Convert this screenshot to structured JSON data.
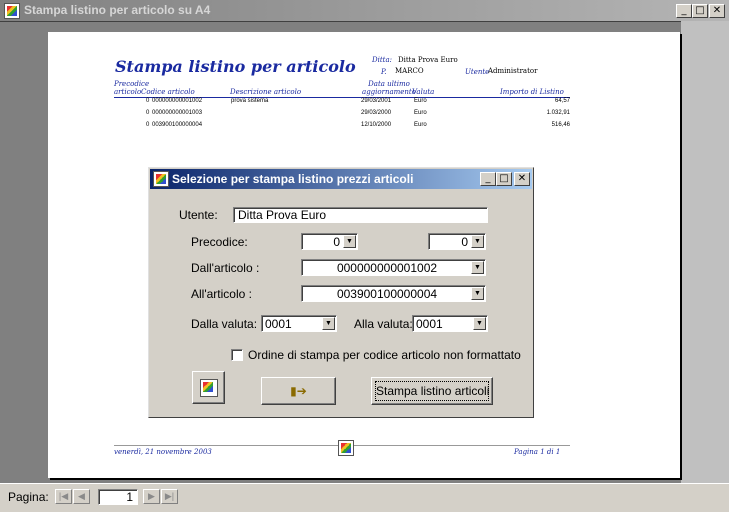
{
  "window": {
    "title": "Stampa listino per articolo su A4"
  },
  "titlebar_buttons": {
    "min": "_",
    "max": "□",
    "close": "✕"
  },
  "report": {
    "title": "Stampa listino per articolo",
    "ditta_label": "Ditta:",
    "ditta_value": "Ditta Prova Euro",
    "p_label": "P.",
    "p_value": "MARCO",
    "utente_label": "Utente",
    "utente_value": "Administrator",
    "columns": {
      "precodice": [
        "Precodice",
        "articolo"
      ],
      "codice": "Codice articolo",
      "descrizione": "Descrizione articolo",
      "data": [
        "Data ultimo",
        "aggiornamento"
      ],
      "valuta": "Valuta",
      "importo": "Importo di Listino"
    },
    "rows": [
      {
        "precodice": "0",
        "codice": "000000000001002",
        "descrizione": "prova sistema",
        "data": "29/03/2001",
        "valuta": "Euro",
        "importo": "64,57"
      },
      {
        "precodice": "0",
        "codice": "000000000001003",
        "descrizione": "",
        "data": "29/03/2000",
        "valuta": "Euro",
        "importo": "1.032,91"
      },
      {
        "precodice": "0",
        "codice": "003900100000004",
        "descrizione": "",
        "data": "12/10/2000",
        "valuta": "Euro",
        "importo": "516,46"
      }
    ],
    "footer_date": "venerdì, 21 novembre 2003",
    "footer_page": "Pagina 1 di 1"
  },
  "dialog": {
    "title": "Selezione per stampa listino prezzi articoli",
    "utente_label": "Utente:",
    "utente_value": "Ditta Prova Euro",
    "precodice_label": "Precodice:",
    "precodice_from": "0",
    "precodice_to": "0",
    "dall_articolo_label": "Dall'articolo :",
    "dall_articolo_value": "000000000001002",
    "all_articolo_label": "All'articolo :",
    "all_articolo_value": "003900100000004",
    "dalla_valuta_label": "Dalla valuta:",
    "dalla_valuta_value": "0001",
    "alla_valuta_label": "Alla valuta:",
    "alla_valuta_value": "0001",
    "checkbox_label": "Ordine di stampa per codice articolo non formattato",
    "checkbox_checked": false,
    "print_button_label": "Stampa listino articoli"
  },
  "statusbar": {
    "page_label": "Pagina:",
    "page_value": "1",
    "first": "|◀",
    "prev": "◀",
    "next": "▶",
    "last": "▶|"
  }
}
